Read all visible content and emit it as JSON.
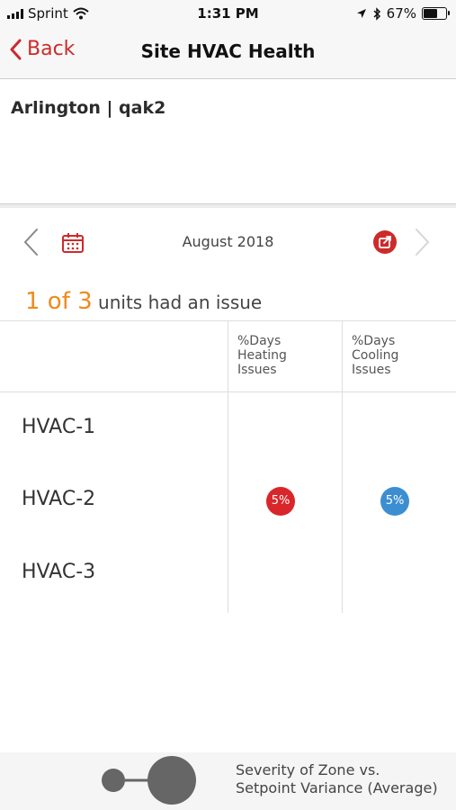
{
  "status_bar": {
    "carrier": "Sprint",
    "time": "1:31 PM",
    "battery": "67%",
    "battery_level": 0.67
  },
  "nav": {
    "back_label": "Back",
    "title": "Site HVAC Health"
  },
  "site": {
    "name": "Arlington | qak2"
  },
  "date_nav": {
    "month": "August 2018"
  },
  "summary": {
    "count": "1 of 3",
    "text": "units had an issue"
  },
  "table": {
    "columns": [
      "%Days\nHeating\nIssues",
      "%Days\nCooling\nIssues"
    ],
    "rows": [
      {
        "unit": "HVAC-1",
        "heating": "",
        "cooling": ""
      },
      {
        "unit": "HVAC-2",
        "heating": "5%",
        "cooling": "5%"
      },
      {
        "unit": "HVAC-3",
        "heating": "",
        "cooling": ""
      }
    ]
  },
  "legend": {
    "text": "Severity of Zone vs.\nSetpoint Variance (Average)"
  },
  "colors": {
    "accent": "#cc2b2b",
    "summary_count": "#f08a1c",
    "heating": "#d9262a",
    "cooling": "#3d8ed1"
  },
  "icons": [
    "signal-icon",
    "wifi-icon",
    "location-arrow-icon",
    "bluetooth-icon",
    "battery-icon",
    "chevron-left-icon",
    "calendar-icon",
    "share-icon",
    "chevron-right-icon",
    "severity-legend-icon"
  ]
}
